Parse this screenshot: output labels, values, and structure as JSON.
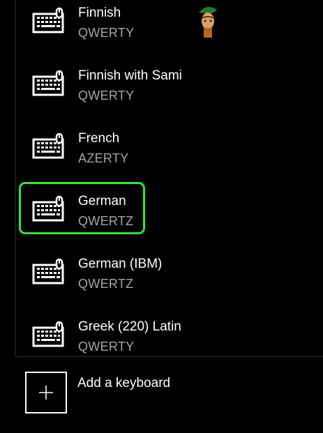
{
  "keyboards": [
    {
      "name": "Finnish",
      "layout": "QWERTY"
    },
    {
      "name": "Finnish with Sami",
      "layout": "QWERTY"
    },
    {
      "name": "French",
      "layout": "AZERTY"
    },
    {
      "name": "German",
      "layout": "QWERTZ",
      "highlighted": true
    },
    {
      "name": "German (IBM)",
      "layout": "QWERTZ"
    },
    {
      "name": "Greek (220) Latin",
      "layout": "QWERTY"
    }
  ],
  "add_keyboard": {
    "label": "Add a keyboard",
    "icon": "plus-icon"
  },
  "icons": {
    "keyboard": "keyboard-icon",
    "watermark": "appuals-logo"
  },
  "colors": {
    "background": "#000000",
    "text_primary": "#ffffff",
    "text_secondary": "#a6a6a6",
    "highlight": "#2ee82e"
  }
}
